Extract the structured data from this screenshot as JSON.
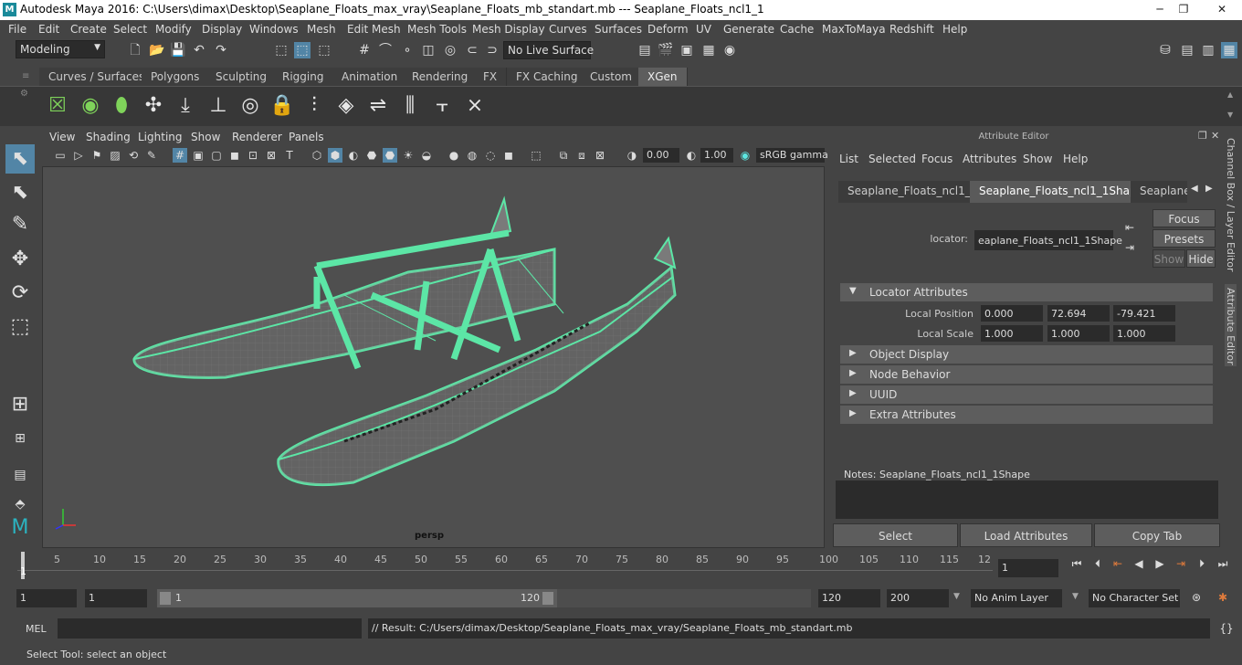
{
  "window": {
    "title": "Autodesk Maya 2016: C:\\Users\\dimax\\Desktop\\Seaplane_Floats_max_vray\\Seaplane_Floats_mb_standart.mb   ---   Seaplane_Floats_ncl1_1",
    "min": "─",
    "restore": "❐",
    "close": "✕"
  },
  "menubar": [
    "File",
    "Edit",
    "Create",
    "Select",
    "Modify",
    "Display",
    "Windows",
    "Mesh",
    "Edit Mesh",
    "Mesh Tools",
    "Mesh Display",
    "Curves",
    "Surfaces",
    "Deform",
    "UV",
    "Generate",
    "Cache",
    "MaxToMaya",
    "Redshift",
    "Help"
  ],
  "statusline": {
    "workspace": "Modeling",
    "live_surface": "No Live Surface"
  },
  "shelf_tabs": [
    "Curves / Surfaces",
    "Polygons",
    "Sculpting",
    "Rigging",
    "Animation",
    "Rendering",
    "FX",
    "FX Caching",
    "Custom",
    "XGen"
  ],
  "shelf_active": "XGen",
  "viewport": {
    "menus": [
      "View",
      "Shading",
      "Lighting",
      "Show",
      "Renderer",
      "Panels"
    ],
    "exposure": "0.00",
    "gamma": "1.00",
    "colorspace": "sRGB gamma",
    "camera": "persp",
    "accent": "#5ce6a6"
  },
  "attribute_editor": {
    "title": "Attribute Editor",
    "menus": [
      "List",
      "Selected",
      "Focus",
      "Attributes",
      "Show",
      "Help"
    ],
    "tabs": [
      "Seaplane_Floats_ncl1_1",
      "Seaplane_Floats_ncl1_1Shape",
      "Seaplane_"
    ],
    "active_tab": "Seaplane_Floats_ncl1_1Shape",
    "node_label": "locator:",
    "node_value": "eaplane_Floats_ncl1_1Shape",
    "focus_btn": "Focus",
    "presets_btn": "Presets",
    "show_btn": "Show",
    "hide_btn": "Hide",
    "sections": [
      "Locator Attributes",
      "Object Display",
      "Node Behavior",
      "UUID",
      "Extra Attributes"
    ],
    "local_position_label": "Local Position",
    "local_position": [
      "0.000",
      "72.694",
      "-79.421"
    ],
    "local_scale_label": "Local Scale",
    "local_scale": [
      "1.000",
      "1.000",
      "1.000"
    ],
    "notes_label": "Notes:  Seaplane_Floats_ncl1_1Shape",
    "buttons": [
      "Select",
      "Load Attributes",
      "Copy Tab"
    ]
  },
  "side_tabs": [
    "Channel Box / Layer Editor",
    "Attribute Editor"
  ],
  "timeline": {
    "ticks": [
      "5",
      "10",
      "15",
      "20",
      "25",
      "30",
      "35",
      "40",
      "45",
      "50",
      "55",
      "60",
      "65",
      "70",
      "75",
      "80",
      "85",
      "90",
      "95",
      "100",
      "105",
      "110",
      "115",
      "12"
    ],
    "start_marker": "1",
    "current_frame": "1"
  },
  "range": {
    "start": "1",
    "playback_start": "1",
    "slider_start": "1",
    "slider_end": "120",
    "playback_end": "120",
    "end": "200",
    "anim_layer": "No Anim Layer",
    "char_set": "No Character Set"
  },
  "cmdline": {
    "label": "MEL",
    "result": "// Result: C:/Users/dimax/Desktop/Seaplane_Floats_max_vray/Seaplane_Floats_mb_standart.mb"
  },
  "help": "Select Tool: select an object"
}
